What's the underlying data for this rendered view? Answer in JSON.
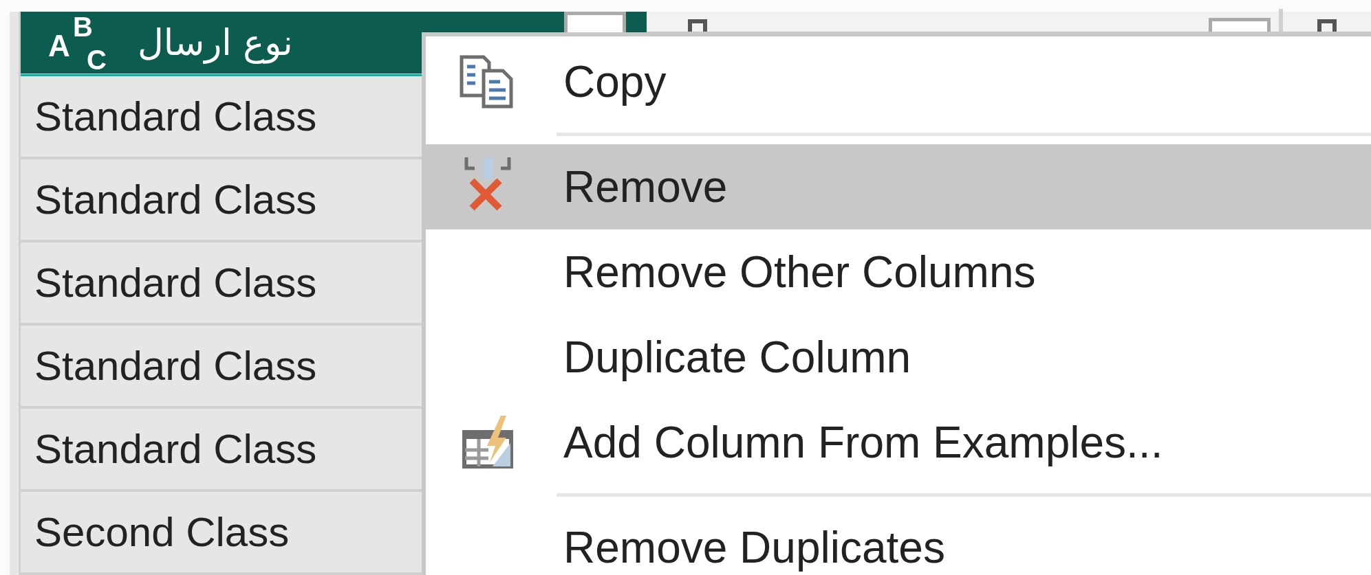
{
  "column": {
    "type_icon": [
      "A",
      "B",
      "C"
    ],
    "title": "نوع ارسال",
    "selected": true
  },
  "rows": [
    "Standard Class",
    "Standard Class",
    "Standard Class",
    "Standard Class",
    "Standard Class",
    "Second Class"
  ],
  "context_menu": [
    {
      "kind": "copy",
      "label": "Copy",
      "selected": false
    },
    {
      "kind": "separator"
    },
    {
      "kind": "remove",
      "label": "Remove",
      "selected": true
    },
    {
      "kind": "plain",
      "label": "Remove Other Columns",
      "selected": false
    },
    {
      "kind": "plain",
      "label": "Duplicate Column",
      "selected": false
    },
    {
      "kind": "examples",
      "label": "Add Column From Examples...",
      "selected": false
    },
    {
      "kind": "separator"
    },
    {
      "kind": "plain",
      "label": "Remove Duplicates",
      "selected": false
    }
  ]
}
